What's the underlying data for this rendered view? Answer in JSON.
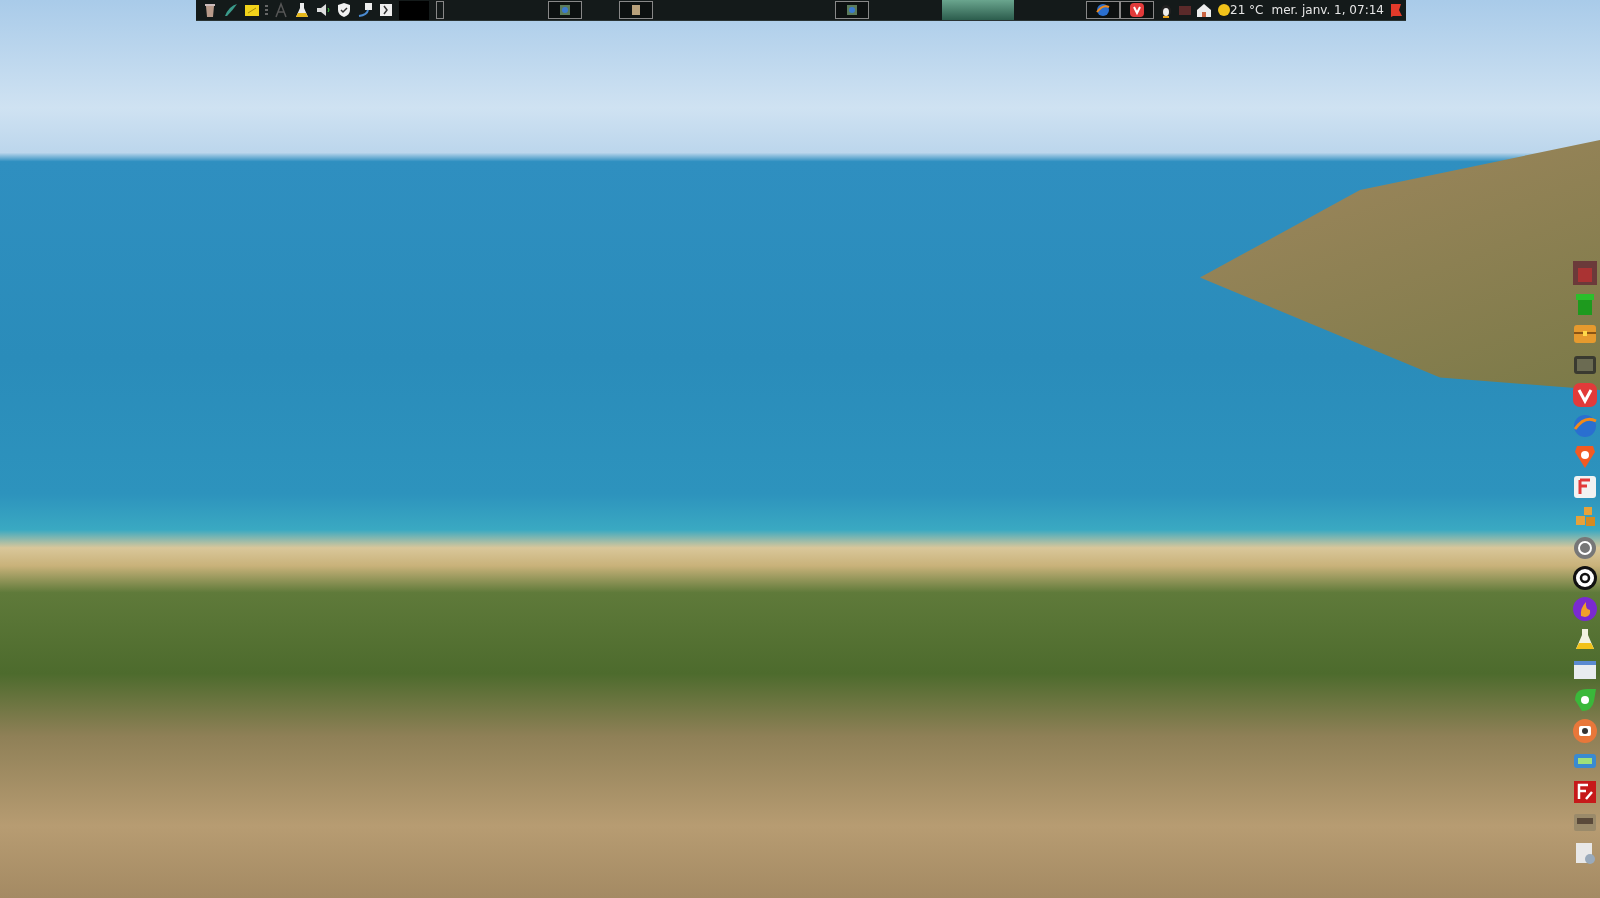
{
  "top_panel": {
    "weather": {
      "temperature": "21 °C"
    },
    "clock": "mer. janv. 1, 07:14"
  }
}
